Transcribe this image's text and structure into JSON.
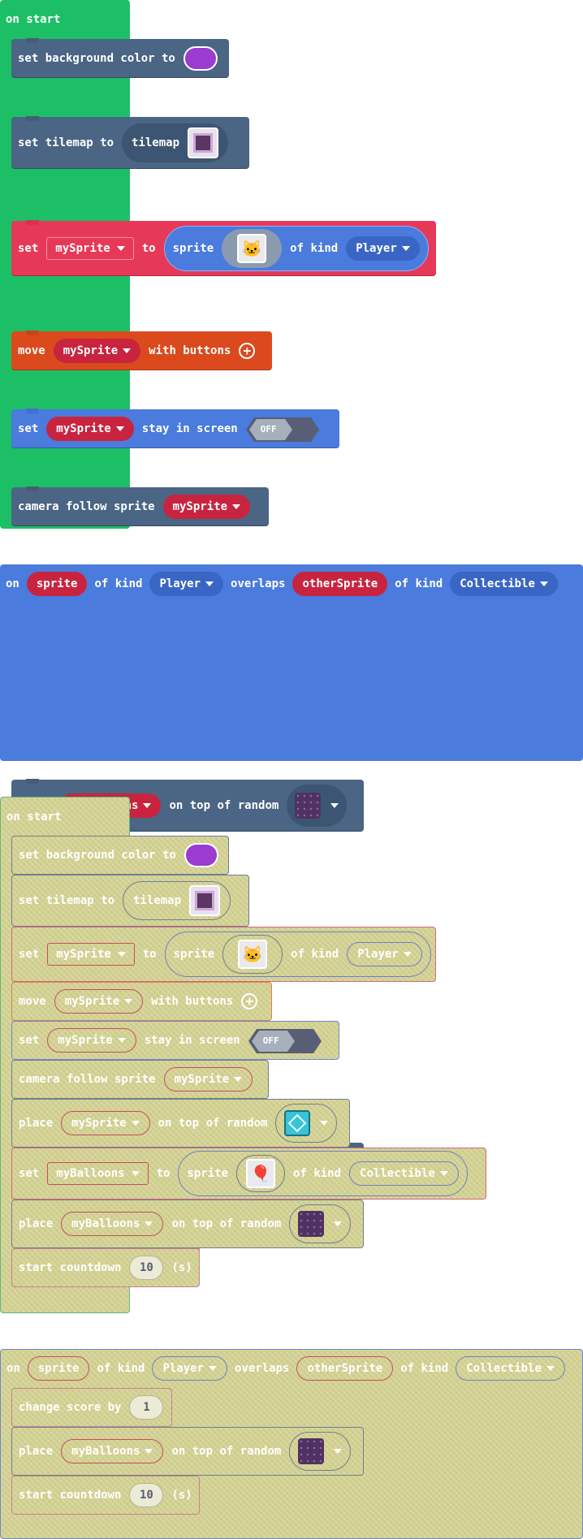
{
  "colors": {
    "event_green": "#1dbf66",
    "event_blue": "#4a7bdd",
    "scene_slate": "#4b6584",
    "sprites_red": "#e63958",
    "controller_orange": "#db4a1c",
    "info_pink": "#d46a87",
    "bg_color_swatch": "#9b3bd0",
    "disabled_fill": "#d3cf8f"
  },
  "on_start": {
    "hat_label": "on start",
    "set_bg": {
      "label": "set background color to"
    },
    "set_tilemap": {
      "label": "set tilemap to",
      "pill": "tilemap"
    },
    "set_sprite": {
      "set": "set",
      "var": "mySprite",
      "to": "to",
      "sprite_word": "sprite",
      "of_kind": "of kind",
      "kind": "Player"
    },
    "move": {
      "label": "move",
      "var": "mySprite",
      "with_buttons": "with buttons"
    },
    "stay_in_screen": {
      "set": "set",
      "var": "mySprite",
      "label": "stay in screen",
      "toggle": "OFF"
    },
    "camera": {
      "label": "camera follow sprite",
      "var": "mySprite"
    },
    "place_sprite": {
      "place": "place",
      "var": "mySprite",
      "label": "on top of random"
    },
    "set_balloons": {
      "set": "set",
      "var": "myBalloons",
      "to": "to",
      "sprite_word": "sprite",
      "of_kind": "of kind",
      "kind": "Collectible"
    },
    "place_balloons": {
      "place": "place",
      "var": "myBalloons",
      "label": "on top of random"
    },
    "countdown": {
      "label": "start countdown",
      "value": "10",
      "unit": "(s)"
    }
  },
  "overlap": {
    "on": "on",
    "sprite": "sprite",
    "of_kind_1": "of kind",
    "kind_1": "Player",
    "overlaps": "overlaps",
    "other": "otherSprite",
    "of_kind_2": "of kind",
    "kind_2": "Collectible",
    "change_score": {
      "label": "change score by",
      "value": "1"
    },
    "place_balloons": {
      "place": "place",
      "var": "myBalloons",
      "label": "on top of random"
    },
    "countdown": {
      "label": "start countdown",
      "value": "10",
      "unit": "(s)"
    }
  }
}
